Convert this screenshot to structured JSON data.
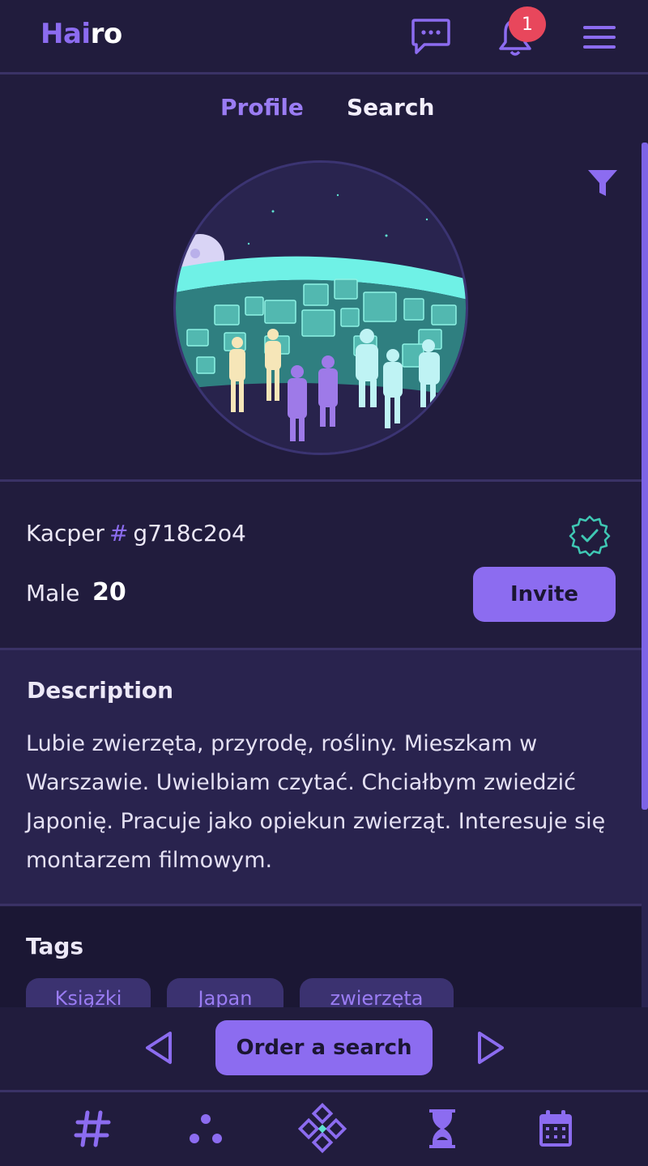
{
  "app": {
    "logo_part1": "Hai",
    "logo_part2": "ro",
    "notification_count": "1"
  },
  "tabs": [
    {
      "label": "Profile",
      "active": true
    },
    {
      "label": "Search",
      "active": false
    }
  ],
  "profile": {
    "name": "Kacper",
    "hash_symbol": "#",
    "tag_id": "g718c2o4",
    "gender": "Male",
    "age": "20",
    "verified": true,
    "invite_label": "Invite"
  },
  "description": {
    "title": "Description",
    "text": "Lubie zwierzęta, przyrodę, rośliny. Mieszkam w Warszawie. Uwielbiam czytać. Chciałbym zwiedzić Japonię. Pracuje jako opiekun zwierząt. Interesuje się montarzem filmowym."
  },
  "tags": {
    "title": "Tags",
    "items": [
      "Książki",
      "Japan",
      "zwierzęta"
    ]
  },
  "controls": {
    "order_label": "Order a search"
  },
  "icons": {
    "chat": "chat-bubble-icon",
    "bell": "bell-icon",
    "menu": "hamburger-menu-icon",
    "filter": "filter-icon",
    "verified": "verified-badge-icon",
    "prev": "triangle-left-icon",
    "next": "triangle-right-icon",
    "nav": [
      "hashtag-icon",
      "dots-icon",
      "diamond-grid-icon",
      "hourglass-icon",
      "calendar-icon"
    ]
  },
  "colors": {
    "background": "#211c3d",
    "accent": "#8c6cf0",
    "badge": "#e8475c",
    "teal": "#3fc7b3"
  }
}
